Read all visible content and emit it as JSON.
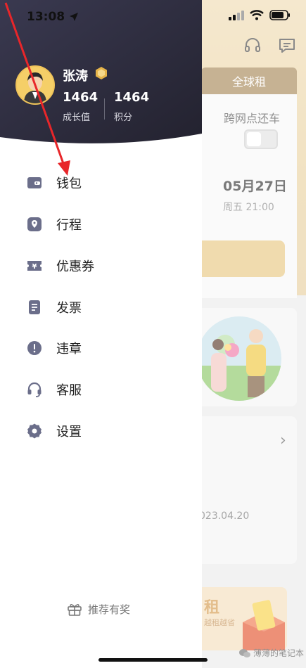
{
  "status": {
    "time": "13:08"
  },
  "drawer": {
    "user": {
      "name": "张涛",
      "growth_value": "1464",
      "growth_label": "成长值",
      "points_value": "1464",
      "points_label": "积分"
    },
    "menu": [
      {
        "label": "钱包",
        "icon": "wallet-icon"
      },
      {
        "label": "行程",
        "icon": "location-pin-icon"
      },
      {
        "label": "优惠券",
        "icon": "coupon-icon"
      },
      {
        "label": "发票",
        "icon": "invoice-icon"
      },
      {
        "label": "违章",
        "icon": "alert-circle-icon"
      },
      {
        "label": "客服",
        "icon": "headset-icon"
      },
      {
        "label": "设置",
        "icon": "gear-icon"
      }
    ],
    "recommend_label": "推荐有奖"
  },
  "background": {
    "tab_label": "全球租",
    "cross_network_label": "跨网点还车",
    "date": "05月27日",
    "time": "周五 21:00",
    "list_date": "023.04.20",
    "promo_title": "租",
    "promo_subtitle": "越租越省",
    "watermark": "薄薄的笔记本"
  },
  "colors": {
    "drawer_header": "#2b2a3d",
    "accent_gold": "#e8c883",
    "icon_color": "#6b6e8a"
  }
}
